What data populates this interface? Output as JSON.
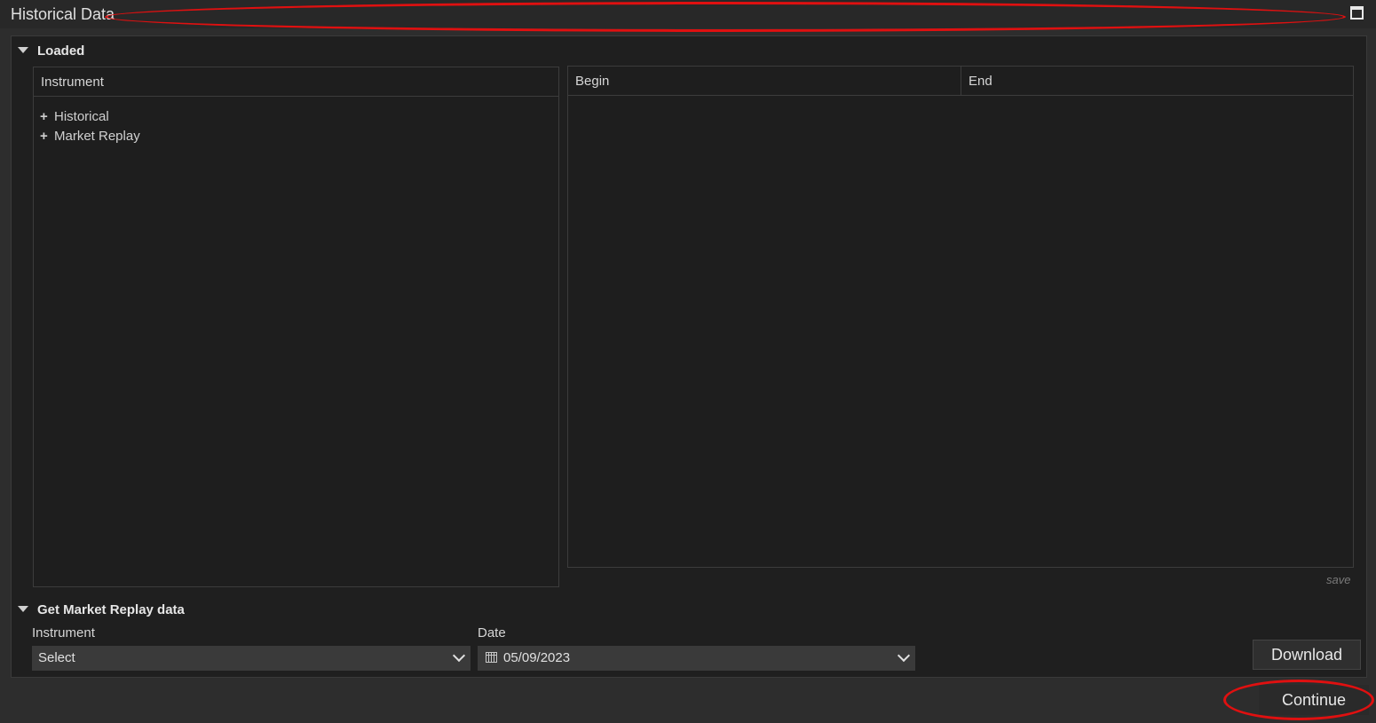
{
  "window": {
    "title": "Historical Data"
  },
  "loaded": {
    "header": "Loaded",
    "instrument_column": "Instrument",
    "begin_column": "Begin",
    "end_column": "End",
    "tree_items": [
      "Historical",
      "Market Replay"
    ],
    "save_label": "save"
  },
  "replay": {
    "header": "Get Market Replay data",
    "instrument_label": "Instrument",
    "instrument_value": "Select",
    "date_label": "Date",
    "date_value": "05/09/2023",
    "download_label": "Download"
  },
  "footer": {
    "continue_label": "Continue"
  },
  "colors": {
    "annotation": "#e01010",
    "background": "#1f1f1f"
  },
  "annotations": [
    "title-bar-ellipse",
    "continue-ellipse"
  ]
}
